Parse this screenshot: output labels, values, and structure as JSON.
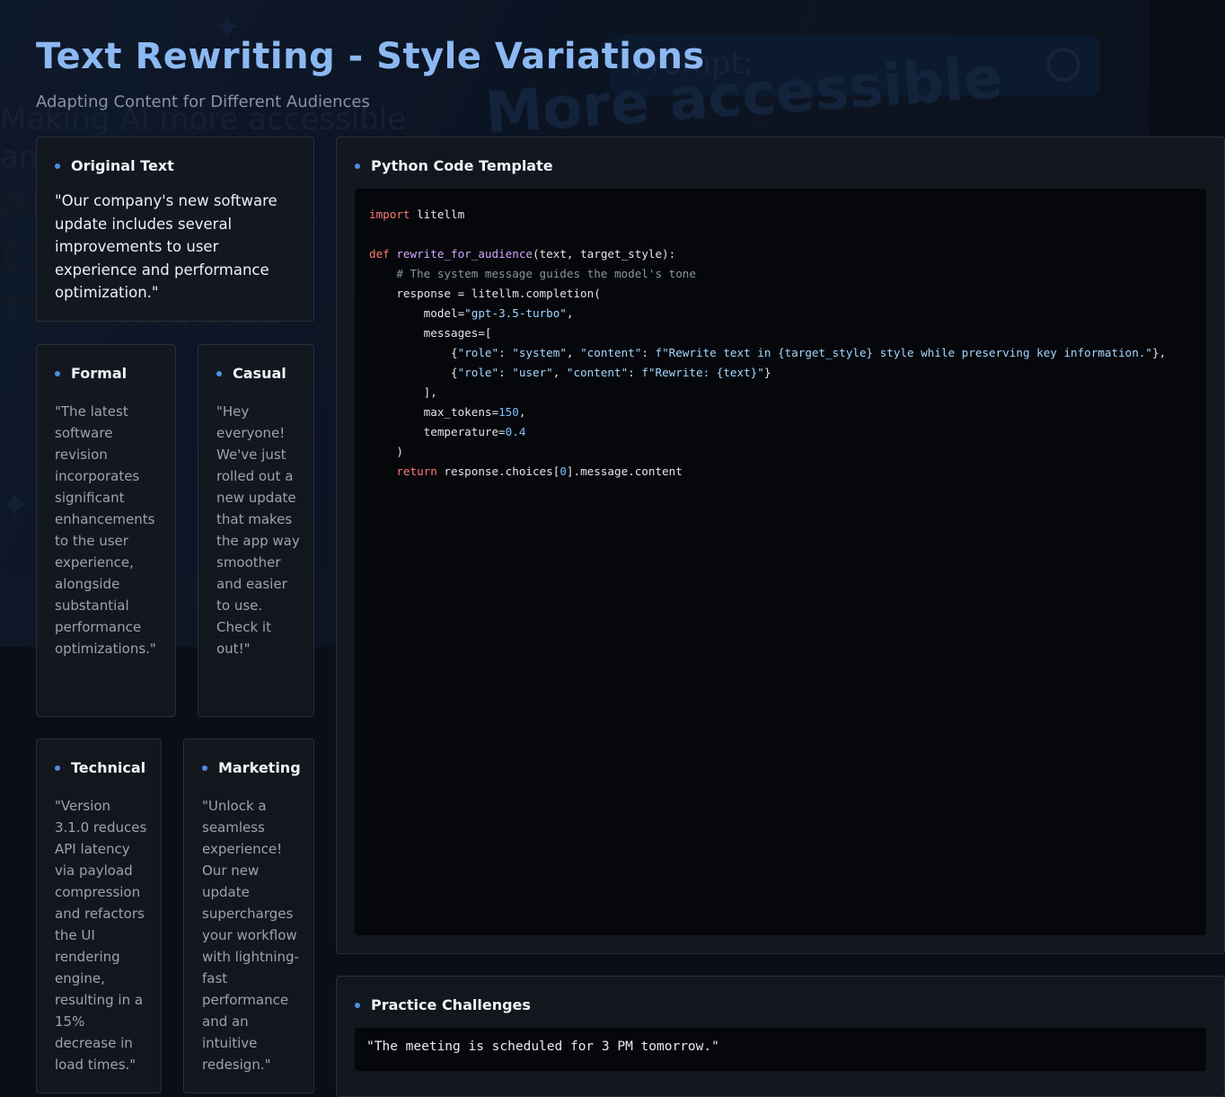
{
  "header": {
    "title": "Text Rewriting - Style Variations",
    "subtitle": "Adapting Content for Different Audiences"
  },
  "background": {
    "search_placeholder": "Prompt:",
    "big_text": "More accessible",
    "left_lines": [
      "Making AI more accessible",
      "an",
      "AD",
      "EN",
      "TECHNIQUES"
    ]
  },
  "original": {
    "title": "Original Text",
    "text": "\"Our company's new software update includes several improvements to user experience and performance optimization.\""
  },
  "styles": [
    {
      "title": "Formal",
      "text": "\"The latest software revision incorporates significant enhancements to the user experience, alongside substantial performance optimizations.\""
    },
    {
      "title": "Casual",
      "text": "\"Hey everyone! We've just rolled out a new update that makes the app way smoother and easier to use. Check it out!\""
    },
    {
      "title": "Technical",
      "text": "\"Version 3.1.0 reduces API latency via payload compression and refactors the UI rendering engine, resulting in a 15% decrease in load times.\""
    },
    {
      "title": "Marketing",
      "text": "\"Unlock a seamless experience! Our new update supercharges your workflow with lightning-fast performance and an intuitive redesign.\""
    }
  ],
  "code_panel": {
    "title": "Python Code Template",
    "lines": {
      "l1_kw": "import",
      "l1_rest": " litellm",
      "l3_kw": "def",
      "l3_fn": "rewrite_for_audience",
      "l3_rest": "(text, target_style):",
      "l4_comment": "    # The system message guides the model's tone",
      "l5": "    response = litellm.completion(",
      "l6_a": "        model=",
      "l6_str": "\"gpt-3.5-turbo\"",
      "l6_b": ",",
      "l7": "        messages=[",
      "l8_a": "            {",
      "l8_s1": "\"role\"",
      "l8_b": ": ",
      "l8_s2": "\"system\"",
      "l8_c": ", ",
      "l8_s3": "\"content\"",
      "l8_d": ": ",
      "l8_s4": "f\"Rewrite text in {target_style} style while preserving key information.\"",
      "l8_e": "},",
      "l9_a": "            {",
      "l9_s1": "\"role\"",
      "l9_b": ": ",
      "l9_s2": "\"user\"",
      "l9_c": ", ",
      "l9_s3": "\"content\"",
      "l9_d": ": ",
      "l9_s4": "f\"Rewrite: {text}\"",
      "l9_e": "}",
      "l10": "        ],",
      "l11_a": "        max_tokens=",
      "l11_num": "150",
      "l11_b": ",",
      "l12_a": "        temperature=",
      "l12_num": "0.4",
      "l13": "    )",
      "l14_kw": "    return",
      "l14_a": " response.choices[",
      "l14_num": "0",
      "l14_b": "].message.content"
    }
  },
  "practice": {
    "title": "Practice Challenges",
    "text": "\"The meeting is scheduled for 3 PM tomorrow.\""
  },
  "colors": {
    "accent": "#4d8fe0",
    "title": "#8cb8f2",
    "panel_bg": "#14181f",
    "code_bg": "#05070b"
  }
}
